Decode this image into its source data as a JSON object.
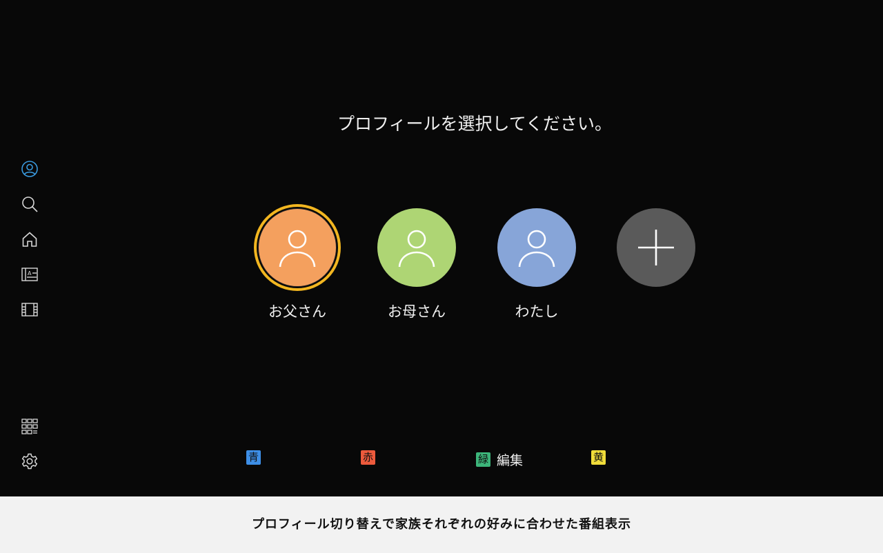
{
  "title": "プロフィールを選択してください。",
  "sidebar": {
    "items": [
      {
        "icon": "profile-icon",
        "color": "#3a9be0"
      },
      {
        "icon": "search-icon",
        "color": "#d8d8d8"
      },
      {
        "icon": "home-icon",
        "color": "#d8d8d8"
      },
      {
        "icon": "tv-guide-icon",
        "color": "#d8d8d8"
      },
      {
        "icon": "video-library-icon",
        "color": "#d8d8d8"
      },
      {
        "icon": "apps-grid-icon",
        "color": "#d8d8d8"
      },
      {
        "icon": "settings-gear-icon",
        "color": "#d8d8d8"
      }
    ]
  },
  "profiles": [
    {
      "name": "お父さん",
      "color": "#f4a05e",
      "selected": true
    },
    {
      "name": "お母さん",
      "color": "#aed574",
      "selected": false
    },
    {
      "name": "わたし",
      "color": "#87a5d8",
      "selected": false
    }
  ],
  "add_profile": {
    "icon": "plus-icon",
    "color": "#5a5a5a"
  },
  "color_keys": [
    {
      "badge": "青",
      "badge_color": "#3d8ee6",
      "label": ""
    },
    {
      "badge": "赤",
      "badge_color": "#ec5a3c",
      "label": ""
    },
    {
      "badge": "緑",
      "badge_color": "#3cb57a",
      "label": "編集"
    },
    {
      "badge": "黄",
      "badge_color": "#f0dc3a",
      "label": ""
    }
  ],
  "caption": "プロフィール切り替えで家族それぞれの好みに合わせた番組表示"
}
